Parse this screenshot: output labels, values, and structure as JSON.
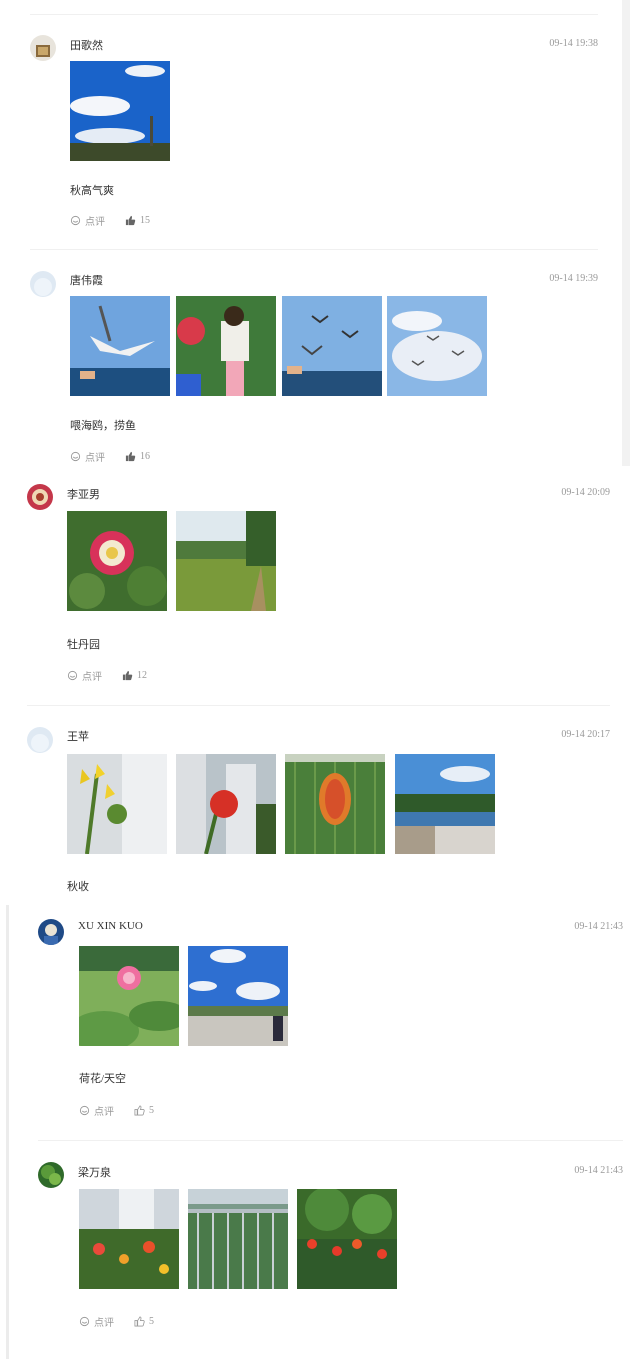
{
  "posts": [
    {
      "author": "田歌然",
      "time": "09-14 19:38",
      "caption": "秋高气爽",
      "comment_label": "点评",
      "likes": "15"
    },
    {
      "author": "唐伟霞",
      "time": "09-14 19:39",
      "caption": "喂海鸥，捞鱼",
      "comment_label": "点评",
      "likes": "16"
    },
    {
      "author": "李亚男",
      "time": "09-14 20:09",
      "caption": "牡丹园",
      "comment_label": "点评",
      "likes": "12"
    },
    {
      "author": "王苹",
      "time": "09-14 20:17",
      "caption": "秋收"
    },
    {
      "author": "XU XIN KUO",
      "time": "09-14 21:43",
      "caption": "荷花/天空",
      "comment_label": "点评",
      "likes": "5"
    },
    {
      "author": "梁万泉",
      "time": "09-14 21:43",
      "comment_label": "点评",
      "likes": "5"
    }
  ],
  "colors": {
    "text": "#333333",
    "muted": "#9a9a9a",
    "divider": "#f0f0f0"
  },
  "icons": {
    "comment": "comment-icon",
    "like": "thumbs-up-icon"
  }
}
